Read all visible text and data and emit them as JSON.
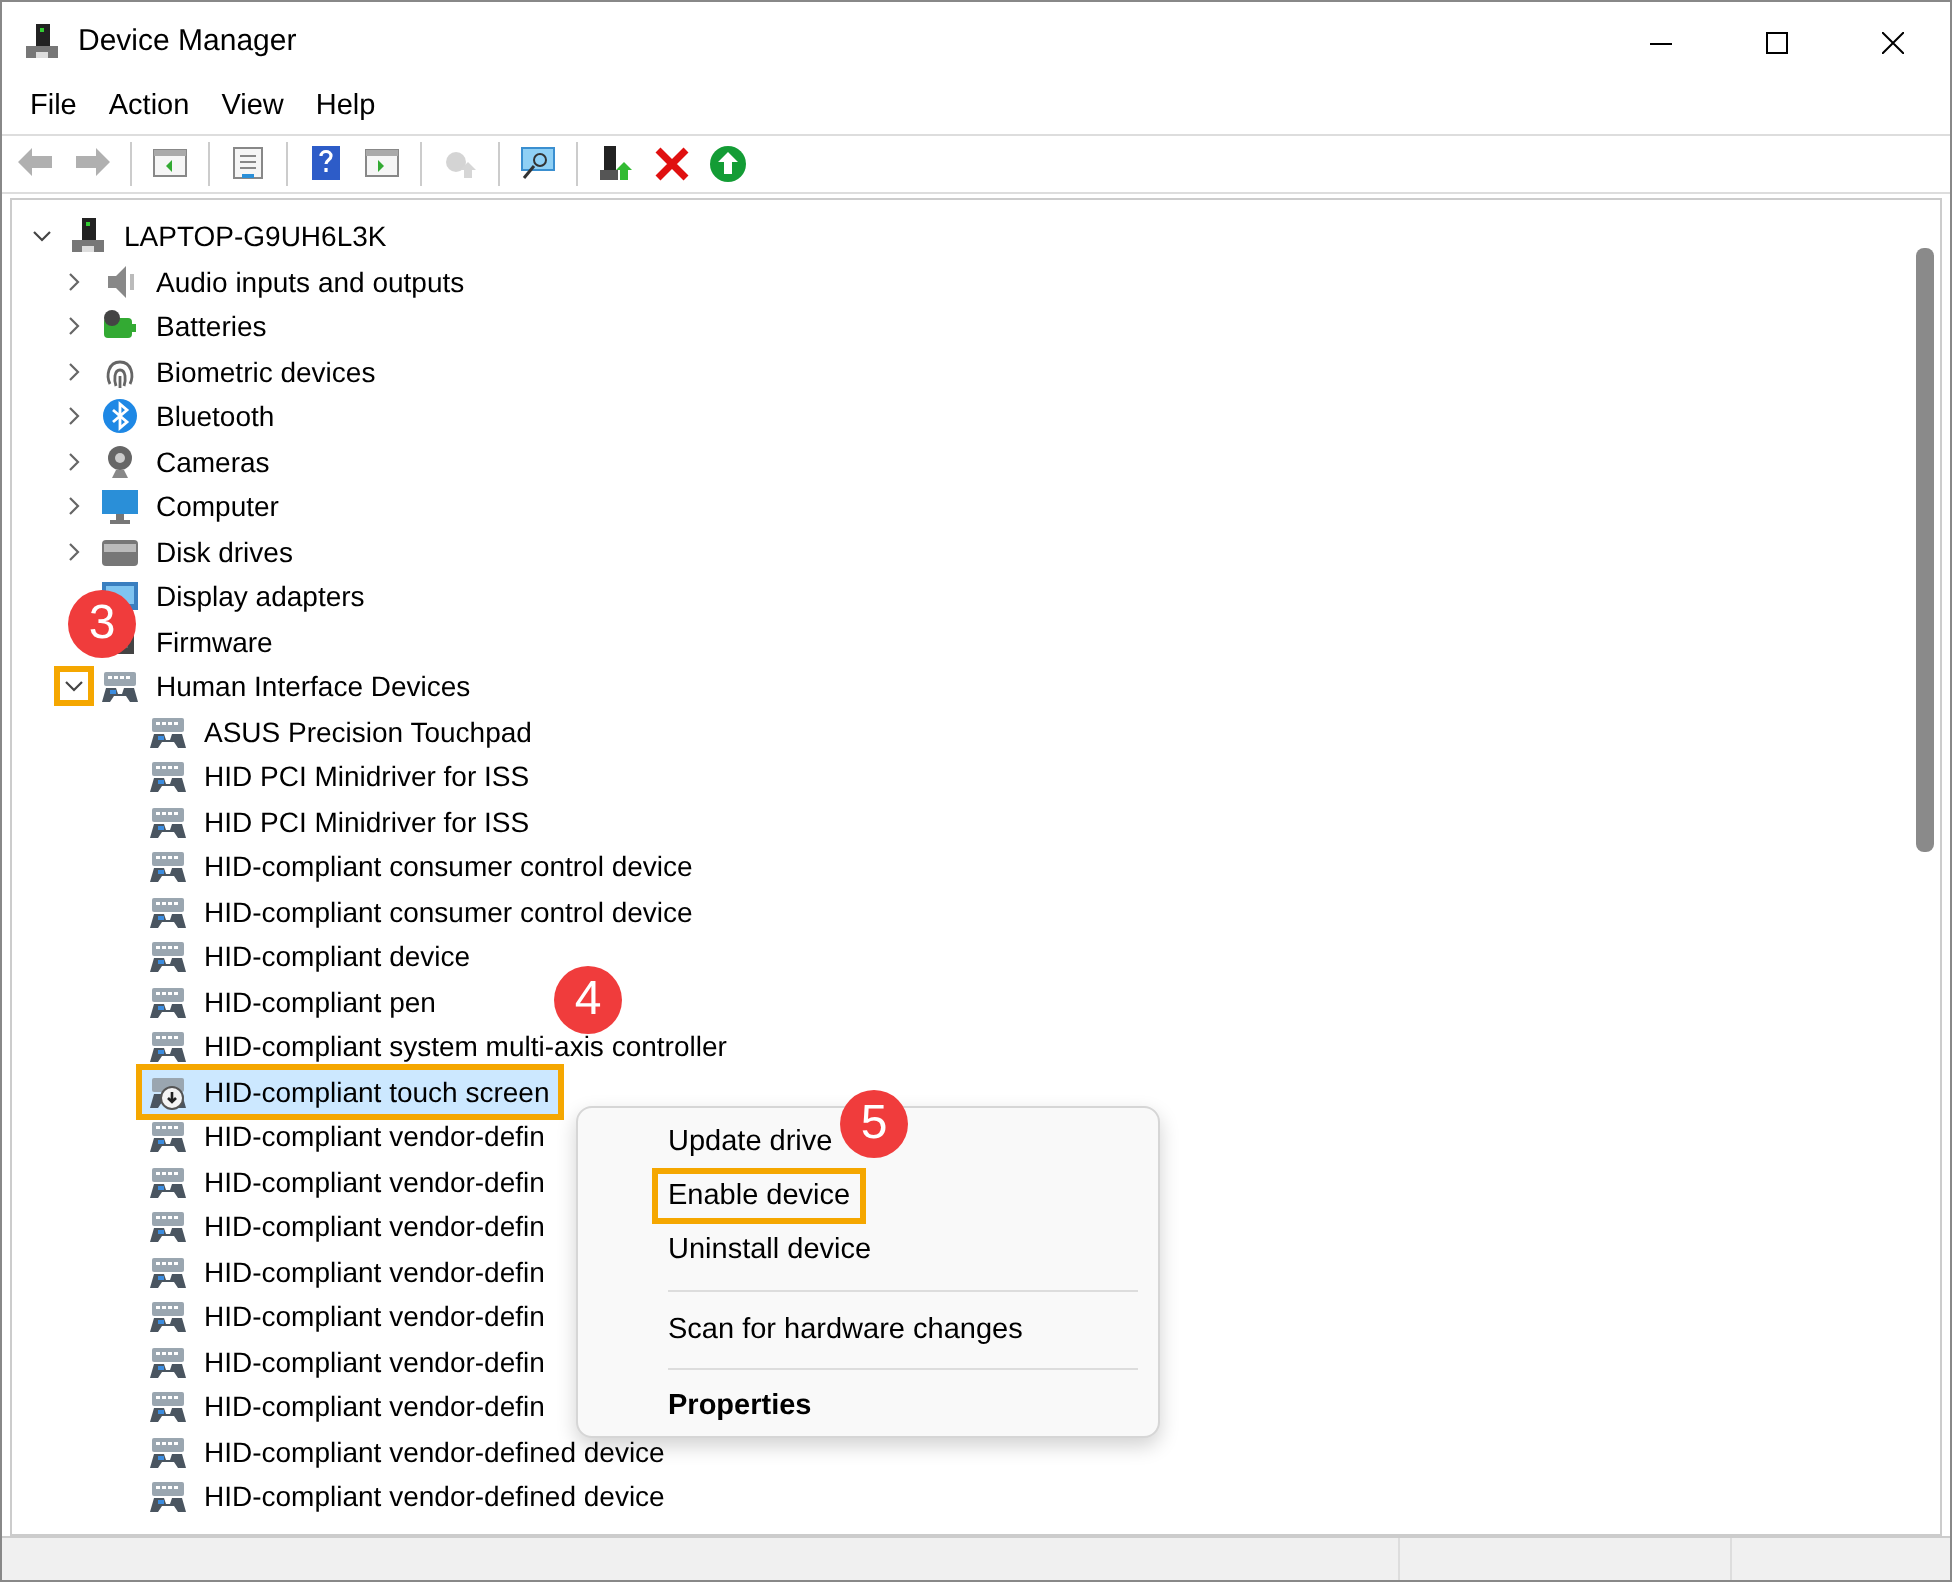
{
  "window": {
    "title": "Device Manager"
  },
  "menu": [
    "File",
    "Action",
    "View",
    "Help"
  ],
  "toolbar": [
    {
      "kind": "back",
      "disabled": true
    },
    {
      "kind": "forward",
      "disabled": true
    },
    {
      "kind": "separator"
    },
    {
      "kind": "console-tree",
      "disabled": false
    },
    {
      "kind": "separator"
    },
    {
      "kind": "properties",
      "disabled": false
    },
    {
      "kind": "separator"
    },
    {
      "kind": "help",
      "disabled": false
    },
    {
      "kind": "action-pane",
      "disabled": false
    },
    {
      "kind": "separator"
    },
    {
      "kind": "update-driver",
      "disabled": true
    },
    {
      "kind": "separator"
    },
    {
      "kind": "scan",
      "disabled": false
    },
    {
      "kind": "separator"
    },
    {
      "kind": "enable-device",
      "disabled": false
    },
    {
      "kind": "uninstall",
      "disabled": false
    },
    {
      "kind": "enable",
      "disabled": false
    }
  ],
  "tree": {
    "label": "LAPTOP-G9UH6L3K",
    "kind": "computer-root",
    "expanded": true,
    "children": [
      {
        "label": "Audio inputs and outputs",
        "kind": "audio",
        "expanded": false,
        "highlighted": false
      },
      {
        "label": "Batteries",
        "kind": "battery",
        "expanded": false,
        "highlighted": false
      },
      {
        "label": "Biometric devices",
        "kind": "biometric",
        "expanded": false,
        "highlighted": false
      },
      {
        "label": "Bluetooth",
        "kind": "bluetooth",
        "expanded": false,
        "highlighted": false
      },
      {
        "label": "Cameras",
        "kind": "camera",
        "expanded": false,
        "highlighted": false
      },
      {
        "label": "Computer",
        "kind": "monitor",
        "expanded": false,
        "highlighted": false
      },
      {
        "label": "Disk drives",
        "kind": "disk",
        "expanded": false,
        "highlighted": false
      },
      {
        "label": "Display adapters",
        "kind": "display",
        "highlighted": false
      },
      {
        "label": "Firmware",
        "kind": "firmware",
        "highlighted": false
      },
      {
        "label": "Human Interface Devices",
        "kind": "hid",
        "expanded": true,
        "highlighted": true,
        "children": [
          {
            "label": "ASUS Precision Touchpad",
            "kind": "hid",
            "selected": false
          },
          {
            "label": "HID PCI Minidriver for ISS",
            "kind": "hid",
            "selected": false
          },
          {
            "label": "HID PCI Minidriver for ISS",
            "kind": "hid",
            "selected": false
          },
          {
            "label": "HID-compliant consumer control device",
            "kind": "hid",
            "selected": false
          },
          {
            "label": "HID-compliant consumer control device",
            "kind": "hid",
            "selected": false
          },
          {
            "label": "HID-compliant device",
            "kind": "hid",
            "selected": false
          },
          {
            "label": "HID-compliant pen",
            "kind": "hid",
            "selected": false
          },
          {
            "label": "HID-compliant system multi-axis controller",
            "kind": "hid",
            "selected": false
          },
          {
            "label": "HID-compliant touch screen",
            "kind": "hid-disabled",
            "selected": true
          },
          {
            "label": "HID-compliant vendor-defin",
            "kind": "hid",
            "selected": false
          },
          {
            "label": "HID-compliant vendor-defin",
            "kind": "hid",
            "selected": false
          },
          {
            "label": "HID-compliant vendor-defin",
            "kind": "hid",
            "selected": false
          },
          {
            "label": "HID-compliant vendor-defin",
            "kind": "hid",
            "selected": false
          },
          {
            "label": "HID-compliant vendor-defin",
            "kind": "hid",
            "selected": false
          },
          {
            "label": "HID-compliant vendor-defin",
            "kind": "hid",
            "selected": false
          },
          {
            "label": "HID-compliant vendor-defin",
            "kind": "hid",
            "selected": false
          },
          {
            "label": "HID-compliant vendor-defined device",
            "kind": "hid",
            "selected": false
          },
          {
            "label": "HID-compliant vendor-defined device",
            "kind": "hid",
            "selected": false
          }
        ]
      }
    ]
  },
  "context_menu": [
    {
      "label": "Update drive",
      "kind": "item",
      "bold": false,
      "highlighted": false
    },
    {
      "label": "Enable device",
      "kind": "item",
      "bold": false,
      "highlighted": true
    },
    {
      "label": "Uninstall device",
      "kind": "item",
      "bold": false,
      "highlighted": false
    },
    {
      "kind": "separator"
    },
    {
      "label": "Scan for hardware changes",
      "kind": "item",
      "bold": false,
      "highlighted": false
    },
    {
      "kind": "separator"
    },
    {
      "label": "Properties",
      "kind": "item",
      "bold": true,
      "highlighted": false
    }
  ],
  "annotations": [
    {
      "label": "3"
    },
    {
      "label": "4"
    },
    {
      "label": "5"
    }
  ]
}
